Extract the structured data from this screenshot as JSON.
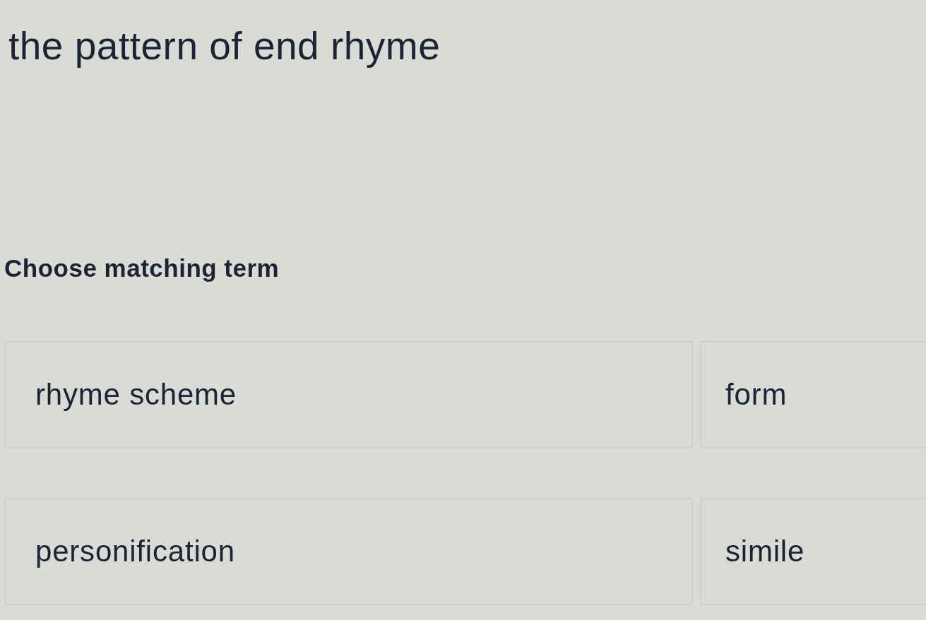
{
  "question": {
    "text": "the pattern of end rhyme"
  },
  "instruction": "Choose matching term",
  "options": [
    {
      "label": "rhyme scheme",
      "selected": false
    },
    {
      "label": "form",
      "selected": false
    },
    {
      "label": "personification",
      "selected": false
    },
    {
      "label": "simile",
      "selected": false
    }
  ]
}
